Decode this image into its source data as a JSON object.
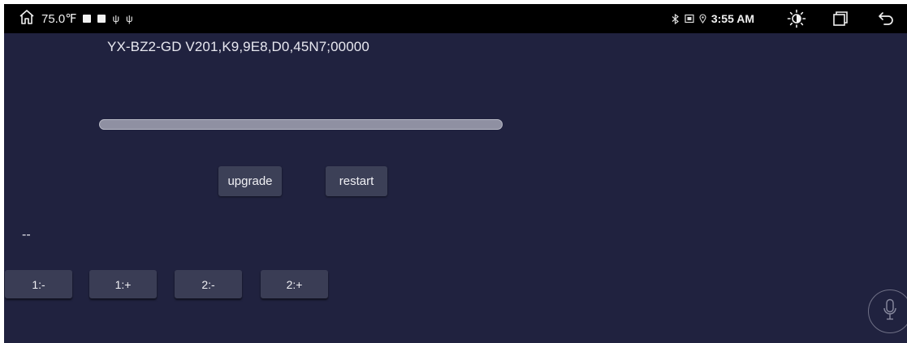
{
  "status_bar": {
    "temperature": "75.0℉",
    "usb_glyph_1": "ψ",
    "usb_glyph_2": "ψ",
    "time": "3:55 AM",
    "icons": [
      "home-icon",
      "bluetooth-icon",
      "sim-icon",
      "location-icon",
      "brightness-icon",
      "recent-apps-icon",
      "back-icon"
    ]
  },
  "main": {
    "version_text": "YX-BZ2-GD V201,K9,9E8,D0,45N7;00000",
    "progress_percent": 0,
    "upgrade_label": "upgrade",
    "restart_label": "restart",
    "status_text": "--",
    "adjust_buttons": [
      "1:-",
      "1:+",
      "2:-",
      "2:+"
    ]
  },
  "mic": {
    "icon": "microphone-icon"
  },
  "colors": {
    "background": "#20223f",
    "status_bar": "#000000",
    "button": "#3c4057",
    "progress_track": "#8f90a2"
  }
}
